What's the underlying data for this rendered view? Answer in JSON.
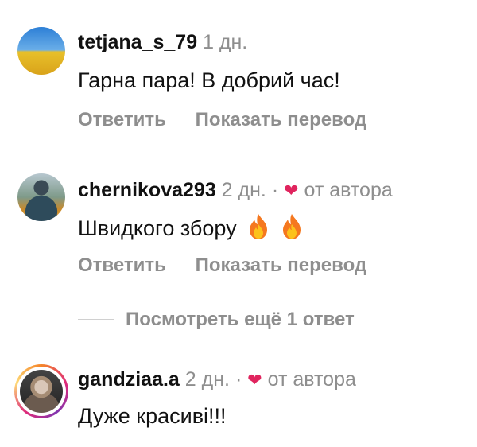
{
  "comments": [
    {
      "username": "tetjana_s_79",
      "time": "1 дн.",
      "text": "Гарна пара! В добрий час!",
      "reply_label": "Ответить",
      "translate_label": "Показать перевод"
    },
    {
      "username": "chernikova293",
      "time": "2 дн.",
      "separator": "·",
      "author_badge": "от автора",
      "text": "Швидкого збору",
      "emoji": "fire-icon fire-icon",
      "reply_label": "Ответить",
      "translate_label": "Показать перевод",
      "more_replies": "Посмотреть ещё 1 ответ"
    },
    {
      "username": "gandziaa.a",
      "time": "2 дн.",
      "separator": "·",
      "author_badge": "от автора",
      "text": "Дуже красиві!!!"
    }
  ],
  "colors": {
    "username": "#111111",
    "meta": "#8e8e8e",
    "heart": "#e0245e"
  }
}
